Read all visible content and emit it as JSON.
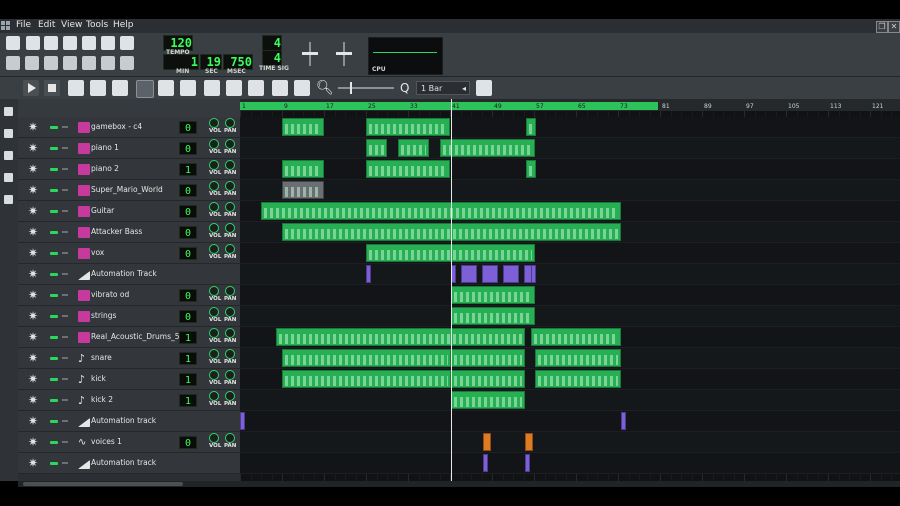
{
  "menu": [
    "File",
    "Edit",
    "View",
    "Tools",
    "Help"
  ],
  "transport": {
    "tempo": "120",
    "tempo_label": "TEMPO",
    "min": "1",
    "min_label": "MIN",
    "sec": "19",
    "sec_label": "SEC",
    "msec": "750",
    "msec_label": "MSEC",
    "time_sig_top": "4",
    "time_sig_bottom": "4",
    "time_sig_label": "TIME SIG",
    "cpu_label": "CPU"
  },
  "song_editor": {
    "zoom_label": "1 Bar",
    "ruler_ticks": [
      "1",
      "9",
      "17",
      "25",
      "33",
      "41",
      "49",
      "57",
      "65",
      "73",
      "81",
      "89",
      "97",
      "105",
      "113",
      "121"
    ]
  },
  "tracks": [
    {
      "name": "gamebox - c4",
      "type": "instrument",
      "vol": "0"
    },
    {
      "name": "piano 1",
      "type": "instrument",
      "vol": "0"
    },
    {
      "name": "piano 2",
      "type": "instrument",
      "vol": "1"
    },
    {
      "name": "Super_Mario_World",
      "type": "instrument",
      "vol": "0"
    },
    {
      "name": "Guitar",
      "type": "instrument",
      "vol": "0"
    },
    {
      "name": "Attacker Bass",
      "type": "instrument",
      "vol": "0"
    },
    {
      "name": "vox",
      "type": "instrument",
      "vol": "0"
    },
    {
      "name": "Automation Track",
      "type": "automation",
      "vol": ""
    },
    {
      "name": "vibrato od",
      "type": "instrument",
      "vol": "0"
    },
    {
      "name": "strings",
      "type": "instrument",
      "vol": "0"
    },
    {
      "name": "Real_Acoustic_Drums_5",
      "type": "instrument",
      "vol": "1"
    },
    {
      "name": "snare",
      "type": "drum",
      "vol": "1"
    },
    {
      "name": "kick",
      "type": "drum",
      "vol": "1"
    },
    {
      "name": "kick 2",
      "type": "drum",
      "vol": "1"
    },
    {
      "name": "Automation track",
      "type": "automation",
      "vol": ""
    },
    {
      "name": "voices 1",
      "type": "wave",
      "vol": "0"
    },
    {
      "name": "Automation track",
      "type": "automation",
      "vol": ""
    }
  ],
  "knob_labels": {
    "vol": "VOL",
    "pan": "PAN"
  },
  "colors": {
    "accent": "#2ad85e",
    "clip": "#27b053",
    "automation_clip": "#7d5fd6",
    "sample_clip": "#e07b22",
    "instrument_icon": "#c63a9e"
  }
}
